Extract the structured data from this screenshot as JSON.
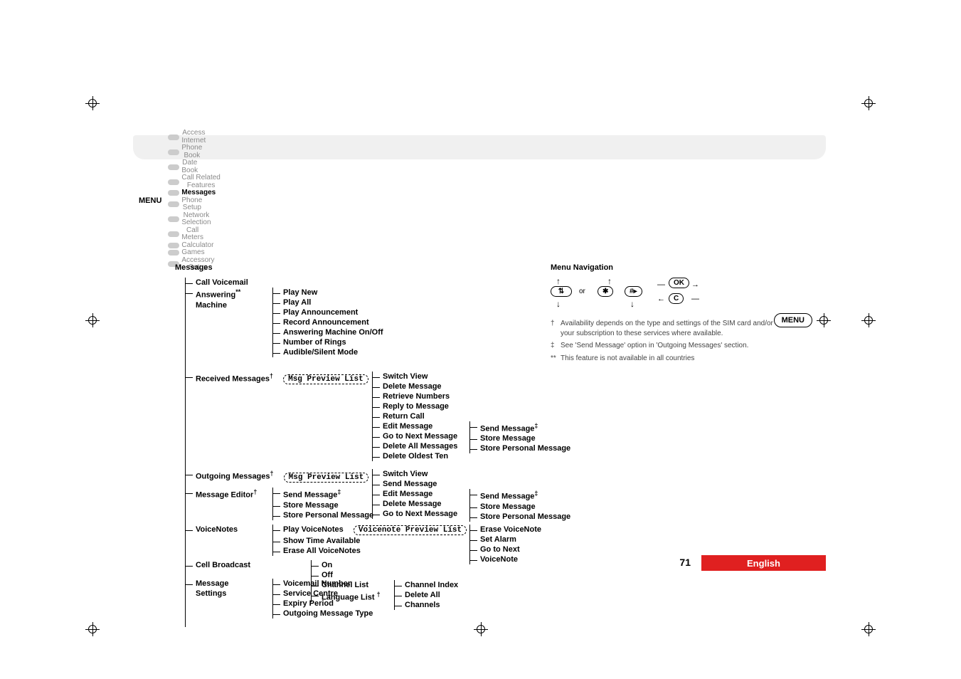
{
  "menubar": {
    "label": "MENU",
    "items": [
      {
        "l1": "Access",
        "l2": "Internet"
      },
      {
        "l1": "Phone",
        "l2": "Book"
      },
      {
        "l1": "Date",
        "l2": "Book"
      },
      {
        "l1": "Call Related",
        "l2": "Features"
      },
      {
        "l1": "Messages",
        "l2": "",
        "active": true
      },
      {
        "l1": "Phone",
        "l2": "Setup"
      },
      {
        "l1": "Network",
        "l2": "Selection"
      },
      {
        "l1": "Call",
        "l2": "Meters"
      },
      {
        "l1": "Calculator",
        "l2": ""
      },
      {
        "l1": "Games",
        "l2": ""
      },
      {
        "l1": "Accessory",
        "l2": "Setup"
      }
    ]
  },
  "tree": {
    "title": "Messages",
    "call_voicemail": "Call Voicemail",
    "answering": {
      "label": "Answering",
      "sup": "**",
      "label2": "Machine",
      "items": [
        "Play New",
        "Play All",
        "Play Announcement",
        "Record Announcement",
        "Answering Machine On/Off",
        "Number of Rings",
        "Audible/Silent Mode"
      ]
    },
    "received": {
      "label": "Received Messages",
      "sup": "†",
      "chip": "Msg Preview List",
      "items": [
        "Switch View",
        "Delete Message",
        "Retrieve Numbers",
        "Reply to Message",
        "Return Call"
      ],
      "edit": {
        "label": "Edit Message",
        "sub": {
          "send": "Send Message",
          "sup": "‡",
          "store": "Store Message",
          "spm": "Store Personal Message"
        }
      },
      "tail": [
        "Go to Next Message",
        "Delete All Messages",
        "Delete Oldest Ten"
      ]
    },
    "outgoing": {
      "label": "Outgoing Messages",
      "sup": "†",
      "chip": "Msg Preview List",
      "items": [
        "Switch View",
        "Send Message"
      ],
      "edit": {
        "label": "Edit Message",
        "sub": {
          "send": "Send Message",
          "sup": "‡",
          "store": "Store Message",
          "spm": "Store Personal Message"
        }
      },
      "tail": [
        "Delete Message",
        "Go to Next Message"
      ]
    },
    "editor": {
      "label": "Message Editor",
      "sup": "†",
      "items": [
        {
          "t": "Send Message",
          "sup": "‡"
        },
        {
          "t": "Store Message"
        },
        {
          "t": "Store Personal Message"
        }
      ]
    },
    "voicenotes": {
      "label": "VoiceNotes",
      "play": {
        "label": "Play VoiceNotes",
        "chip": "Voicenote Preview List",
        "sub": [
          "Erase VoiceNote",
          "Set Alarm",
          "Go to Next",
          "VoiceNote"
        ]
      },
      "items": [
        "Show Time Available",
        "Erase All VoiceNotes"
      ]
    },
    "cellbc": {
      "label": "Cell Broadcast",
      "items": [
        "On",
        "Off",
        "Channel List"
      ],
      "lang": {
        "label": "Language List",
        "sup": "†"
      },
      "chsub": [
        "Channel Index",
        "Delete All",
        "Channels"
      ]
    },
    "settings": {
      "label": "Message",
      "label2": "Settings",
      "items": [
        "Voicemail Number",
        "Service Centre",
        "Expiry Period",
        "Outgoing Message Type"
      ]
    }
  },
  "right": {
    "title": "Menu Navigation",
    "or": "or",
    "keys": {
      "star": "✱",
      "hash": "#▸",
      "ok": "OK",
      "c": "C"
    },
    "notes": [
      {
        "mark": "†",
        "text": "Availability depends on the type and settings of the SIM card and/or your subscription to these services where available."
      },
      {
        "mark": "‡",
        "text": "See 'Send Message' option in 'Outgoing Messages' section."
      },
      {
        "mark": "**",
        "text": "This feature is not available in all countries"
      }
    ]
  },
  "badge": "MENU",
  "footer": {
    "page": "71",
    "lang": "English"
  }
}
